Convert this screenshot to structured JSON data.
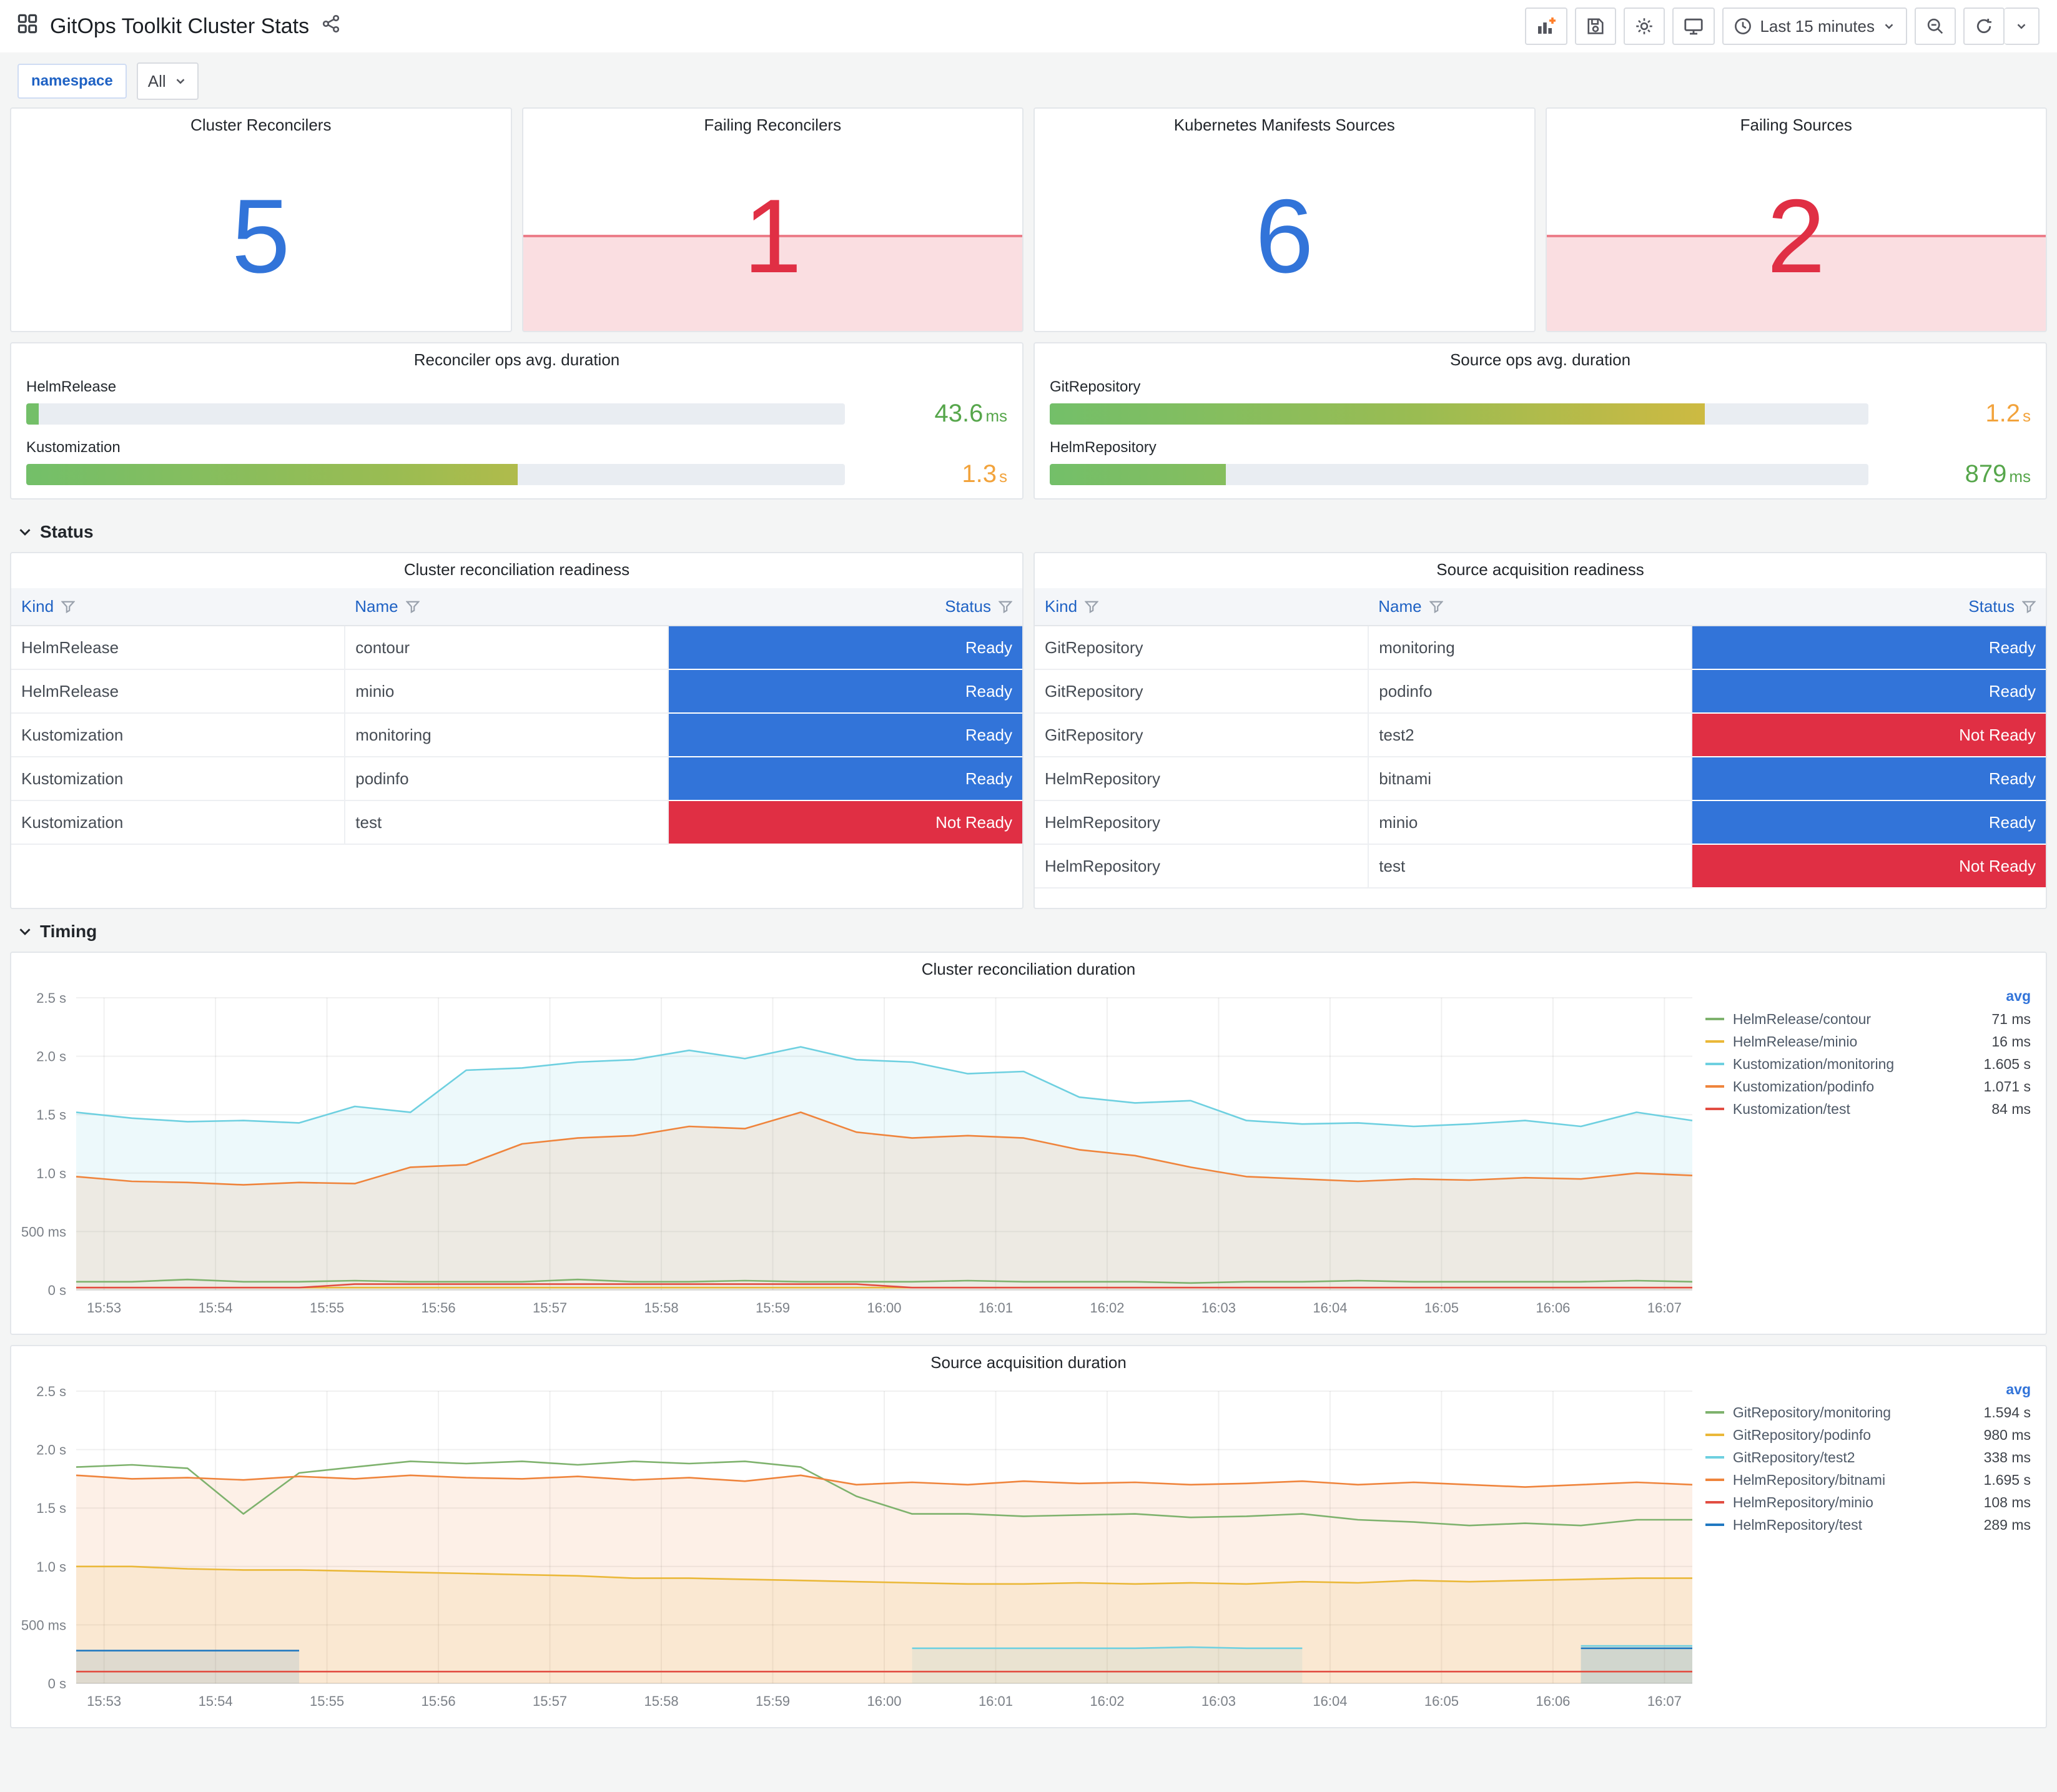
{
  "header": {
    "title": "GitOps Toolkit Cluster Stats",
    "time_range": "Last 15 minutes",
    "toolbar_icons": [
      "add-panel",
      "save",
      "dashboard-settings",
      "tv-mode",
      "time-range",
      "zoom-out",
      "refresh",
      "refresh-interval-caret"
    ]
  },
  "variables": {
    "label": "namespace",
    "value": "All"
  },
  "sections": {
    "status": "Status",
    "timing": "Timing"
  },
  "colors": {
    "stat_blue": "#3274D9",
    "stat_red": "#E02F44",
    "ready": "#3274D9",
    "not_ready": "#E02F44",
    "gauge_green": "#73BF69",
    "gauge_yellow": "#EAB839",
    "value_green": "#56A64B",
    "value_amber": "#F2A33C"
  },
  "stats": [
    {
      "title": "Cluster Reconcilers",
      "value": "5",
      "color": "#3274D9",
      "band": false
    },
    {
      "title": "Failing Reconcilers",
      "value": "1",
      "color": "#E02F44",
      "band": true
    },
    {
      "title": "Kubernetes Manifests Sources",
      "value": "6",
      "color": "#3274D9",
      "band": false
    },
    {
      "title": "Failing Sources",
      "value": "2",
      "color": "#E02F44",
      "band": true
    }
  ],
  "gauges": [
    {
      "title": "Reconciler ops avg. duration",
      "rows": [
        {
          "label": "HelmRelease",
          "value": "43.6",
          "unit": "ms",
          "pct": 1.5,
          "value_color": "#56A64B"
        },
        {
          "label": "Kustomization",
          "value": "1.3",
          "unit": "s",
          "pct": 60,
          "value_color": "#F2A33C"
        }
      ]
    },
    {
      "title": "Source ops avg. duration",
      "rows": [
        {
          "label": "GitRepository",
          "value": "1.2",
          "unit": "s",
          "pct": 80,
          "value_color": "#F2A33C"
        },
        {
          "label": "HelmRepository",
          "value": "879",
          "unit": "ms",
          "pct": 21.5,
          "value_color": "#56A64B"
        }
      ]
    }
  ],
  "tables": [
    {
      "title": "Cluster reconciliation readiness",
      "columns": [
        "Kind",
        "Name",
        "Status"
      ],
      "rows": [
        {
          "kind": "HelmRelease",
          "name": "contour",
          "status": "Ready",
          "ready": true
        },
        {
          "kind": "HelmRelease",
          "name": "minio",
          "status": "Ready",
          "ready": true
        },
        {
          "kind": "Kustomization",
          "name": "monitoring",
          "status": "Ready",
          "ready": true
        },
        {
          "kind": "Kustomization",
          "name": "podinfo",
          "status": "Ready",
          "ready": true
        },
        {
          "kind": "Kustomization",
          "name": "test",
          "status": "Not Ready",
          "ready": false
        }
      ]
    },
    {
      "title": "Source acquisition readiness",
      "columns": [
        "Kind",
        "Name",
        "Status"
      ],
      "rows": [
        {
          "kind": "GitRepository",
          "name": "monitoring",
          "status": "Ready",
          "ready": true
        },
        {
          "kind": "GitRepository",
          "name": "podinfo",
          "status": "Ready",
          "ready": true
        },
        {
          "kind": "GitRepository",
          "name": "test2",
          "status": "Not Ready",
          "ready": false
        },
        {
          "kind": "HelmRepository",
          "name": "bitnami",
          "status": "Ready",
          "ready": true
        },
        {
          "kind": "HelmRepository",
          "name": "minio",
          "status": "Ready",
          "ready": true
        },
        {
          "kind": "HelmRepository",
          "name": "test",
          "status": "Not Ready",
          "ready": false
        }
      ]
    }
  ],
  "chart_data": [
    {
      "type": "line",
      "title": "Cluster reconciliation duration",
      "ylim": [
        0,
        2.5
      ],
      "xlim": [
        52.75,
        67.25
      ],
      "yticks": {
        "values": [
          0,
          0.5,
          1,
          1.5,
          2,
          2.5
        ],
        "labels": [
          "0 s",
          "500 ms",
          "1.0 s",
          "1.5 s",
          "2.0 s",
          "2.5 s"
        ]
      },
      "xticks": {
        "values": [
          53,
          54,
          55,
          56,
          57,
          58,
          59,
          60,
          61,
          62,
          63,
          64,
          65,
          66,
          67
        ],
        "labels": [
          "15:53",
          "15:54",
          "15:55",
          "15:56",
          "15:57",
          "15:58",
          "15:59",
          "16:00",
          "16:01",
          "16:02",
          "16:03",
          "16:04",
          "16:05",
          "16:06",
          "16:07"
        ]
      },
      "legend_header": "avg",
      "x": [
        52.75,
        53.25,
        53.75,
        54.25,
        54.75,
        55.25,
        55.75,
        56.25,
        56.75,
        57.25,
        57.75,
        58.25,
        58.75,
        59.25,
        59.75,
        60.25,
        60.75,
        61.25,
        61.75,
        62.25,
        62.75,
        63.25,
        63.75,
        64.25,
        64.75,
        65.25,
        65.75,
        66.25,
        66.75,
        67.25
      ],
      "series": [
        {
          "name": "HelmRelease/contour",
          "color": "#7EB26D",
          "avg": "71 ms",
          "fill": false,
          "y": [
            0.07,
            0.07,
            0.09,
            0.07,
            0.07,
            0.08,
            0.07,
            0.07,
            0.07,
            0.09,
            0.07,
            0.07,
            0.08,
            0.07,
            0.07,
            0.07,
            0.08,
            0.07,
            0.07,
            0.07,
            0.06,
            0.07,
            0.07,
            0.08,
            0.07,
            0.07,
            0.07,
            0.07,
            0.08,
            0.07
          ]
        },
        {
          "name": "HelmRelease/minio",
          "color": "#EAB839",
          "avg": "16 ms",
          "fill": false,
          "y": [
            0.02,
            0.02,
            0.02,
            0.02,
            0.02,
            0.02,
            0.02,
            0.02,
            0.02,
            0.02,
            0.02,
            0.02,
            0.02,
            0.02,
            0.02,
            0.02,
            0.02,
            0.02,
            0.02,
            0.02,
            0.02,
            0.02,
            0.02,
            0.02,
            0.02,
            0.02,
            0.02,
            0.02,
            0.02,
            0.02
          ]
        },
        {
          "name": "Kustomization/monitoring",
          "color": "#6ED0E0",
          "avg": "1.605 s",
          "fill": true,
          "y": [
            1.52,
            1.47,
            1.44,
            1.45,
            1.43,
            1.57,
            1.52,
            1.88,
            1.9,
            1.95,
            1.97,
            2.05,
            1.98,
            2.08,
            1.97,
            1.95,
            1.85,
            1.87,
            1.65,
            1.6,
            1.62,
            1.45,
            1.42,
            1.43,
            1.4,
            1.42,
            1.45,
            1.4,
            1.52,
            1.45
          ]
        },
        {
          "name": "Kustomization/podinfo",
          "color": "#EF843C",
          "avg": "1.071 s",
          "fill": true,
          "y": [
            0.97,
            0.93,
            0.92,
            0.9,
            0.92,
            0.91,
            1.05,
            1.07,
            1.25,
            1.3,
            1.32,
            1.4,
            1.38,
            1.52,
            1.35,
            1.3,
            1.32,
            1.3,
            1.2,
            1.15,
            1.05,
            0.97,
            0.95,
            0.93,
            0.95,
            0.94,
            0.96,
            0.95,
            1.0,
            0.98
          ]
        },
        {
          "name": "Kustomization/test",
          "color": "#E24D42",
          "avg": "84 ms",
          "fill": false,
          "y": [
            0.02,
            0.02,
            0.02,
            0.02,
            0.02,
            0.05,
            0.05,
            0.05,
            0.05,
            0.05,
            0.05,
            0.05,
            0.05,
            0.05,
            0.05,
            0.02,
            0.02,
            0.02,
            0.02,
            0.02,
            0.02,
            0.02,
            0.02,
            0.02,
            0.02,
            0.02,
            0.02,
            0.02,
            0.02,
            0.02
          ]
        }
      ]
    },
    {
      "type": "line",
      "title": "Source acquisition duration",
      "ylim": [
        0,
        2.5
      ],
      "xlim": [
        52.75,
        67.25
      ],
      "yticks": {
        "values": [
          0,
          0.5,
          1,
          1.5,
          2,
          2.5
        ],
        "labels": [
          "0 s",
          "500 ms",
          "1.0 s",
          "1.5 s",
          "2.0 s",
          "2.5 s"
        ]
      },
      "xticks": {
        "values": [
          53,
          54,
          55,
          56,
          57,
          58,
          59,
          60,
          61,
          62,
          63,
          64,
          65,
          66,
          67
        ],
        "labels": [
          "15:53",
          "15:54",
          "15:55",
          "15:56",
          "15:57",
          "15:58",
          "15:59",
          "16:00",
          "16:01",
          "16:02",
          "16:03",
          "16:04",
          "16:05",
          "16:06",
          "16:07"
        ]
      },
      "legend_header": "avg",
      "x": [
        52.75,
        53.25,
        53.75,
        54.25,
        54.75,
        55.25,
        55.75,
        56.25,
        56.75,
        57.25,
        57.75,
        58.25,
        58.75,
        59.25,
        59.75,
        60.25,
        60.75,
        61.25,
        61.75,
        62.25,
        62.75,
        63.25,
        63.75,
        64.25,
        64.75,
        65.25,
        65.75,
        66.25,
        66.75,
        67.25
      ],
      "series": [
        {
          "name": "GitRepository/monitoring",
          "color": "#7EB26D",
          "avg": "1.594 s",
          "fill": false,
          "y": [
            1.85,
            1.87,
            1.84,
            1.45,
            1.8,
            1.85,
            1.9,
            1.88,
            1.9,
            1.87,
            1.9,
            1.88,
            1.9,
            1.85,
            1.6,
            1.45,
            1.45,
            1.43,
            1.44,
            1.45,
            1.42,
            1.43,
            1.45,
            1.4,
            1.38,
            1.35,
            1.37,
            1.35,
            1.4,
            1.4
          ]
        },
        {
          "name": "GitRepository/podinfo",
          "color": "#EAB839",
          "avg": "980 ms",
          "fill": true,
          "y": [
            1.0,
            1.0,
            0.98,
            0.97,
            0.97,
            0.96,
            0.95,
            0.94,
            0.93,
            0.92,
            0.9,
            0.9,
            0.89,
            0.88,
            0.87,
            0.86,
            0.85,
            0.85,
            0.86,
            0.85,
            0.86,
            0.85,
            0.87,
            0.86,
            0.88,
            0.87,
            0.88,
            0.89,
            0.9,
            0.9
          ]
        },
        {
          "name": "GitRepository/test2",
          "color": "#6ED0E0",
          "avg": "338 ms",
          "fill": true,
          "y": [
            null,
            null,
            null,
            null,
            null,
            null,
            null,
            null,
            null,
            null,
            null,
            null,
            null,
            null,
            null,
            0.3,
            0.3,
            0.3,
            0.3,
            0.3,
            0.31,
            0.3,
            0.3,
            null,
            null,
            null,
            null,
            0.32,
            0.32,
            0.32
          ]
        },
        {
          "name": "HelmRepository/bitnami",
          "color": "#EF843C",
          "avg": "1.695 s",
          "fill": true,
          "y": [
            1.78,
            1.75,
            1.76,
            1.74,
            1.77,
            1.75,
            1.78,
            1.76,
            1.75,
            1.77,
            1.74,
            1.76,
            1.73,
            1.78,
            1.7,
            1.72,
            1.7,
            1.73,
            1.71,
            1.72,
            1.7,
            1.71,
            1.73,
            1.7,
            1.72,
            1.7,
            1.68,
            1.7,
            1.72,
            1.7
          ]
        },
        {
          "name": "HelmRepository/minio",
          "color": "#E24D42",
          "avg": "108 ms",
          "fill": false,
          "y": [
            0.1,
            0.1,
            0.1,
            0.1,
            0.1,
            0.1,
            0.1,
            0.1,
            0.1,
            0.1,
            0.1,
            0.1,
            0.1,
            0.1,
            0.1,
            0.1,
            0.1,
            0.1,
            0.1,
            0.1,
            0.1,
            0.1,
            0.1,
            0.1,
            0.1,
            0.1,
            0.1,
            0.1,
            0.1,
            0.1
          ]
        },
        {
          "name": "HelmRepository/test",
          "color": "#1F78C1",
          "avg": "289 ms",
          "fill": true,
          "y": [
            0.28,
            0.28,
            0.28,
            0.28,
            0.28,
            null,
            null,
            null,
            null,
            null,
            null,
            null,
            null,
            null,
            null,
            null,
            null,
            null,
            null,
            null,
            null,
            null,
            null,
            null,
            null,
            null,
            null,
            0.3,
            0.3,
            0.3
          ]
        }
      ]
    }
  ]
}
